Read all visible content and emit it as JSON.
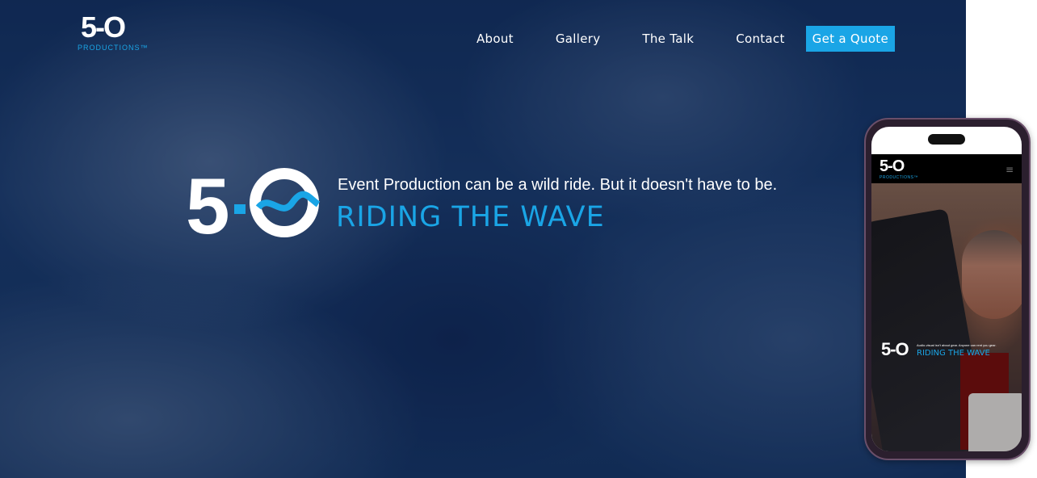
{
  "brand": {
    "logo_text": "5-O",
    "logo_tagline": "PRODUCTIONS™",
    "accent_color": "#1aa5e6"
  },
  "nav": {
    "items": [
      {
        "label": "About"
      },
      {
        "label": "Gallery"
      },
      {
        "label": "The Talk"
      },
      {
        "label": "Contact"
      }
    ],
    "cta_label": "Get a Quote"
  },
  "hero": {
    "headline": "Event Production can be a wild ride. But it doesn't have to be.",
    "subheadline": "RIDING THE WAVE",
    "logo_text": "5-O"
  },
  "mobile_preview": {
    "logo_text": "5-O",
    "logo_tagline": "PRODUCTIONS™",
    "menu_icon": "hamburger-icon",
    "hero_small_text": "Audio-visual isn't about gear. Anyone can rent you gear.",
    "hero_big_text": "RIDING THE WAVE",
    "hero_logo_text": "5-O"
  }
}
